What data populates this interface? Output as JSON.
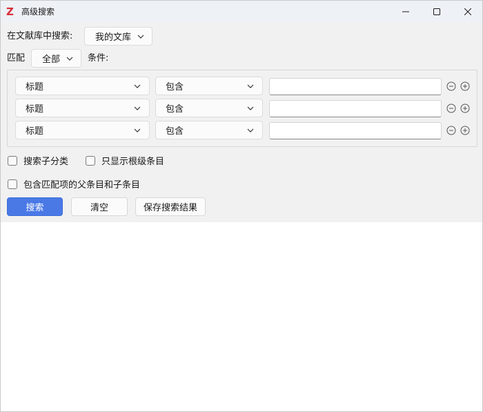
{
  "window": {
    "title": "高级搜索",
    "app_icon_glyph": "Z",
    "accent_color": "#d72e3a"
  },
  "library": {
    "label": "在文献库中搜索:",
    "selected": "我的文库"
  },
  "match": {
    "label": "匹配",
    "selected": "全部",
    "conditions_label": "条件:"
  },
  "conditions": [
    {
      "field": "标题",
      "operator": "包含",
      "value": ""
    },
    {
      "field": "标题",
      "operator": "包含",
      "value": ""
    },
    {
      "field": "标题",
      "operator": "包含",
      "value": ""
    }
  ],
  "options": {
    "search_subcollections": "搜索子分类",
    "show_only_top_level": "只显示根级条目",
    "include_parent_child": "包含匹配项的父条目和子条目"
  },
  "buttons": {
    "search": "搜索",
    "clear": "清空",
    "save_search": "保存搜索结果"
  },
  "colors": {
    "primary_button": "#4a79e6",
    "panel_background": "#f1f1f1",
    "titlebar_background": "#eef1f5"
  }
}
